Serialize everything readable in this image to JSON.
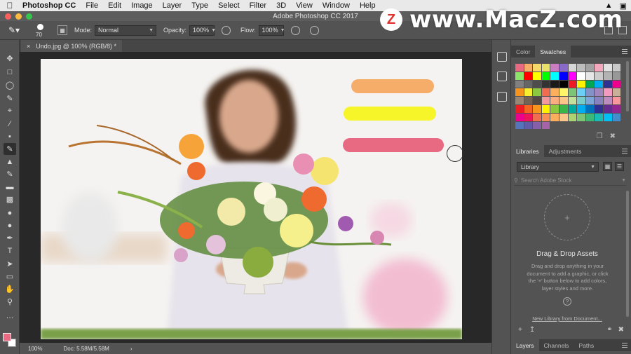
{
  "colors": {
    "menubar_bg": "#e9e9e9",
    "panel_bg": "#535353",
    "canvas_bg": "#282828",
    "foreground": "#e76a82",
    "background": "#ffffff",
    "stroke_orange": "#f6ad6a",
    "stroke_yellow": "#f5f52a",
    "stroke_pink": "#e76a82"
  },
  "menubar": {
    "app": "Photoshop CC",
    "items": [
      "File",
      "Edit",
      "Image",
      "Layer",
      "Type",
      "Select",
      "Filter",
      "3D",
      "View",
      "Window",
      "Help"
    ]
  },
  "window": {
    "title": "Adobe Photoshop CC 2017"
  },
  "options": {
    "brush_size": "70",
    "mode_label": "Mode:",
    "mode_value": "Normal",
    "opacity_label": "Opacity:",
    "opacity_value": "100%",
    "flow_label": "Flow:",
    "flow_value": "100%"
  },
  "document": {
    "tab_close": "×",
    "tab_title": "Undo.jpg @ 100% (RGB/8) *"
  },
  "status": {
    "zoom": "100%",
    "doc": "Doc: 5.58M/5.58M",
    "arrow": "›"
  },
  "panels": {
    "color_tabs": [
      "Color",
      "Swatches"
    ],
    "library_tabs": [
      "Libraries",
      "Adjustments"
    ],
    "library_select": "Library",
    "stock_placeholder": "Search Adobe Stock",
    "drop_title": "Drag & Drop Assets",
    "drop_desc": "Drag and drop anything in your document to add a graphic, or click the '+' button below to add colors, layer styles and more.",
    "new_library": "New Library from Document...",
    "bottom_tabs": [
      "Layers",
      "Channels",
      "Paths"
    ]
  },
  "swatches": [
    "#e76a82",
    "#f6ad6a",
    "#f6d76a",
    "#e9e26a",
    "#c97ec2",
    "#8a6ac9",
    "#d7d7d7",
    "#bdbdbd",
    "#a2a2a2",
    "#f3a8bd",
    "#e1e1e1",
    "#c9c9c9",
    "#8be36a",
    "#ff0000",
    "#ffff00",
    "#00ff00",
    "#00ffff",
    "#0000ff",
    "#ff00ff",
    "#ffffff",
    "#e6e6e6",
    "#cccccc",
    "#b3b3b3",
    "#999999",
    "#808080",
    "#666666",
    "#4d4d4d",
    "#333333",
    "#1a1a1a",
    "#000000",
    "#ed1c24",
    "#fff200",
    "#00a651",
    "#00aeef",
    "#2e3192",
    "#ec008c",
    "#f7941d",
    "#f9ed32",
    "#8dc63f",
    "#f26c4f",
    "#fbaf5d",
    "#fff568",
    "#7cc576",
    "#6dcff6",
    "#8393ca",
    "#a186be",
    "#f49ac1",
    "#c7b299",
    "#998675",
    "#736357",
    "#534741",
    "#f5989d",
    "#f9ad81",
    "#fdc689",
    "#c4df9b",
    "#7accc8",
    "#7ea7d8",
    "#8882be",
    "#bc8cbf",
    "#f6989d",
    "#ee1d24",
    "#f26522",
    "#f7941d",
    "#fff200",
    "#8dc63f",
    "#39b54a",
    "#00a99d",
    "#00aeef",
    "#0072bc",
    "#2e3192",
    "#662d91",
    "#92278f",
    "#ec008c",
    "#ed145b",
    "#f26c4f",
    "#f68e55",
    "#fbaf5d",
    "#fdc68a",
    "#acd373",
    "#7cc576",
    "#3bb878",
    "#1abbb4",
    "#00bff3",
    "#448ccb",
    "#5674b9",
    "#605ca8",
    "#855fa8",
    "#a763a8"
  ],
  "watermark": {
    "logo_letter": "Z",
    "text": "www.MacZ.com"
  }
}
